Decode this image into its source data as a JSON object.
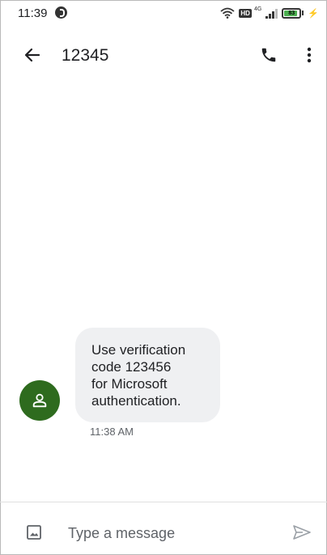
{
  "status_bar": {
    "time": "11:39",
    "network_badge": "HD",
    "network_type": "4G",
    "battery_level": "83",
    "icons": [
      "data-saver-icon",
      "wifi-icon",
      "hd-icon",
      "signal-icon",
      "battery-icon",
      "charging-icon"
    ]
  },
  "app_bar": {
    "title": "12345",
    "icons": [
      "back-arrow-icon",
      "phone-icon",
      "more-vert-icon"
    ]
  },
  "conversation": {
    "messages": [
      {
        "lines": [
          "Use verification",
          "code 123456",
          "for Microsoft",
          "authentication."
        ],
        "time": "11:38 AM",
        "direction": "incoming"
      }
    ],
    "avatar_icon": "person-icon",
    "avatar_color": "#2e6b1e",
    "bubble_color": "#eff0f2"
  },
  "compose": {
    "placeholder": "Type a message",
    "value": "",
    "icons": [
      "image-icon",
      "send-icon"
    ]
  }
}
